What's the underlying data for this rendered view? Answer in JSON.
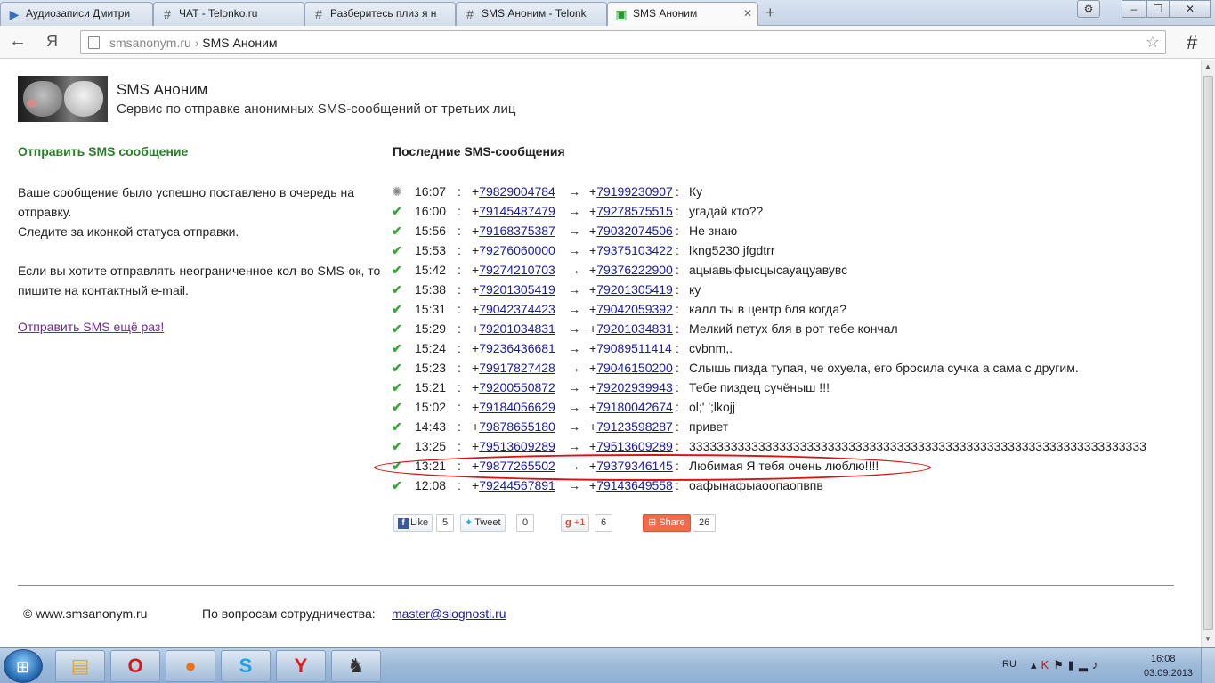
{
  "browser": {
    "tabs": [
      {
        "title": "Аудиозаписи Дмитри",
        "icon": "play-icon"
      },
      {
        "title": "ЧАТ - Telonko.ru",
        "icon": "hash-icon"
      },
      {
        "title": "Разберитесь плиз я н",
        "icon": "hash-icon"
      },
      {
        "title": "SMS Аноним - Telonk",
        "icon": "hash-icon"
      },
      {
        "title": "SMS Аноним",
        "icon": "chat-icon",
        "active": true
      }
    ],
    "address": {
      "domain": "smsanonym.ru",
      "separator": "›",
      "page": "SMS Аноним"
    },
    "ya_label": "Я"
  },
  "site": {
    "title": "SMS Аноним",
    "subtitle": "Сервис по отправке анонимных SMS-сообщений от третьих лиц"
  },
  "left": {
    "heading": "Отправить SMS сообщение",
    "para1_line1": "Ваше сообщение было успешно поставлено в очередь на отправку.",
    "para1_line2": "Следите за иконкой статуса отправки.",
    "para2": "Если вы хотите отправлять неограниченное кол-во SMS-ок, то пишите на контактный e-mail.",
    "resend_link": "Отправить SMS ещё раз!"
  },
  "right": {
    "heading": "Последние SMS-сообщения",
    "messages": [
      {
        "status": "pending",
        "time": "16:07",
        "from": "79829004784",
        "to": "79199230907",
        "text": "Ку"
      },
      {
        "status": "sent",
        "time": "16:00",
        "from": "79145487479",
        "to": "79278575515",
        "text": "угадай кто??"
      },
      {
        "status": "sent",
        "time": "15:56",
        "from": "79168375387",
        "to": "79032074506",
        "text": "Не знаю"
      },
      {
        "status": "sent",
        "time": "15:53",
        "from": "79276060000",
        "to": "79375103422",
        "text": "lkng5230 jfgdtrr"
      },
      {
        "status": "sent",
        "time": "15:42",
        "from": "79274210703",
        "to": "79376222900",
        "text": "ацыавыфысцысауацуавувс"
      },
      {
        "status": "sent",
        "time": "15:38",
        "from": "79201305419",
        "to": "79201305419",
        "text": "ку"
      },
      {
        "status": "sent",
        "time": "15:31",
        "from": "79042374423",
        "to": "79042059392",
        "text": "калл ты в центр бля когда?"
      },
      {
        "status": "sent",
        "time": "15:29",
        "from": "79201034831",
        "to": "79201034831",
        "text": "Мелкий петух бля в рот тебе кончал"
      },
      {
        "status": "sent",
        "time": "15:24",
        "from": "79236436681",
        "to": "79089511414",
        "text": "cvbnm,."
      },
      {
        "status": "sent",
        "time": "15:23",
        "from": "79917827428",
        "to": "79046150200",
        "text": "Слышь пизда тупая, че охуела, его бросила сучка а сама с другим."
      },
      {
        "status": "sent",
        "time": "15:21",
        "from": "79200550872",
        "to": "79202939943",
        "text": "Тебе пиздец сучёныш !!!"
      },
      {
        "status": "sent",
        "time": "15:02",
        "from": "79184056629",
        "to": "79180042674",
        "text": "ol;' ';lkojj"
      },
      {
        "status": "sent",
        "time": "14:43",
        "from": "79878655180",
        "to": "79123598287",
        "text": "привет"
      },
      {
        "status": "sent",
        "time": "13:25",
        "from": "79513609289",
        "to": "79513609289",
        "text": "333333333333333333333333333333333333333333333333333333333333333333"
      },
      {
        "status": "sent",
        "time": "13:21",
        "from": "79877265502",
        "to": "79379346145",
        "text": "Любимая Я тебя очень люблю!!!!"
      },
      {
        "status": "sent",
        "time": "12:08",
        "from": "79244567891",
        "to": "79143649558",
        "text": "оафынафыаоопаопвпв"
      }
    ],
    "highlight_row": 14
  },
  "share": {
    "fb_label": "Like",
    "fb_count": "5",
    "tw_label": "Tweet",
    "tw_count": "0",
    "gp_label": "+1",
    "gp_count": "6",
    "share_label": "Share",
    "share_count": "26"
  },
  "footer": {
    "copyright": "© www.smsanonym.ru",
    "contact_label": "По вопросам сотрудничества:",
    "contact_email": "master@slognosti.ru"
  },
  "taskbar": {
    "apps": [
      "explorer-icon",
      "opera-icon",
      "firefox-icon",
      "skype-icon",
      "yandex-browser-icon",
      "counter-strike-icon"
    ],
    "lang": "RU",
    "time": "16:08",
    "date": "03.09.2013"
  },
  "colors": {
    "accent_green": "#2a7d2a",
    "link": "#1a1aa6",
    "visited": "#6a2d91",
    "highlight": "#dd1111"
  }
}
